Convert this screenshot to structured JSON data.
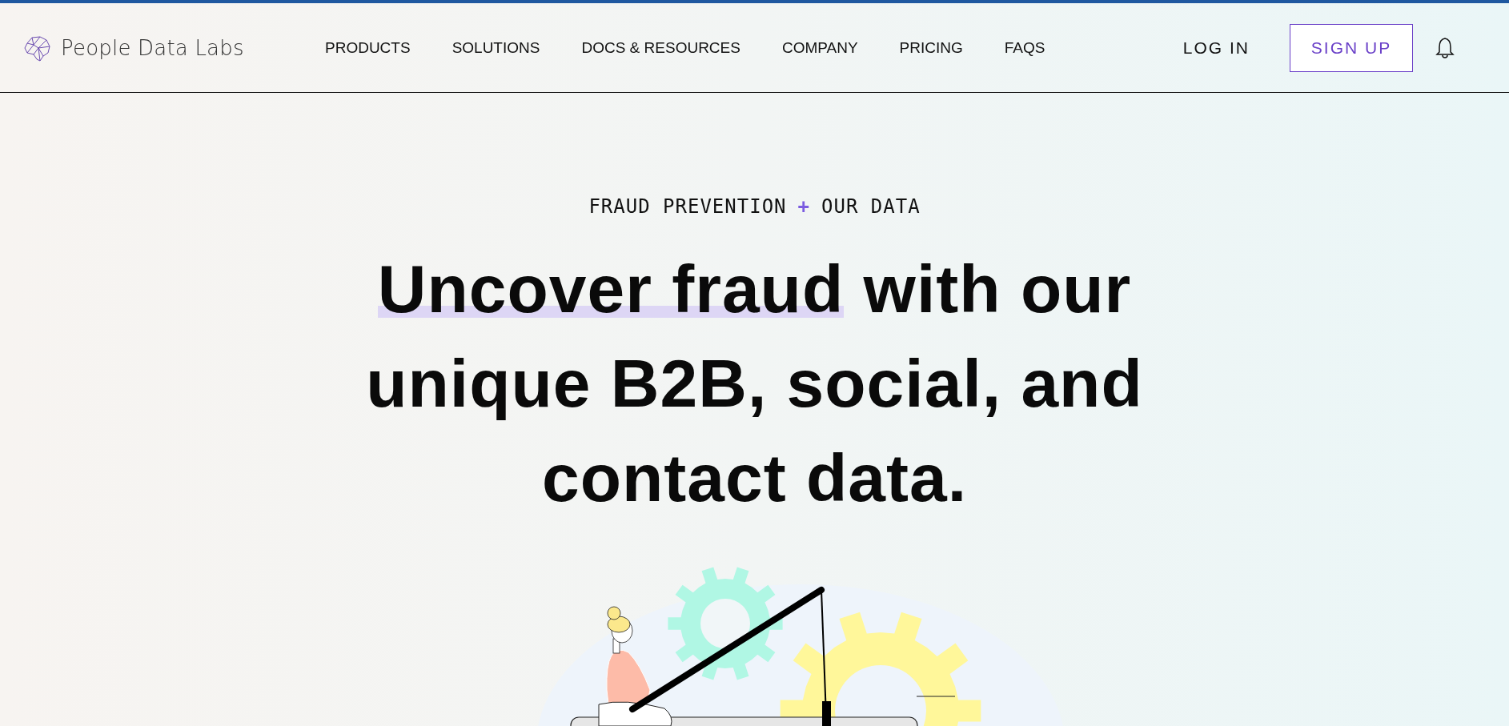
{
  "brand": {
    "name": "People Data Labs"
  },
  "nav": [
    "PRODUCTS",
    "SOLUTIONS",
    "DOCS & RESOURCES",
    "COMPANY",
    "PRICING",
    "FAQS"
  ],
  "actions": {
    "login": "LOG IN",
    "signup": "SIGN UP"
  },
  "hero": {
    "eyebrow": {
      "left": "FRAUD PREVENTION",
      "joiner": "+",
      "right": "OUR DATA"
    },
    "headline": [
      [
        {
          "text": "Uncover fraud",
          "highlight": true
        },
        {
          "text": "with our",
          "highlight": false
        }
      ],
      [
        {
          "text": "unique B2B, social, and",
          "highlight": false
        }
      ],
      [
        {
          "text": "contact data.",
          "highlight": false
        }
      ]
    ],
    "illustration": {
      "kind": "picture"
    }
  }
}
